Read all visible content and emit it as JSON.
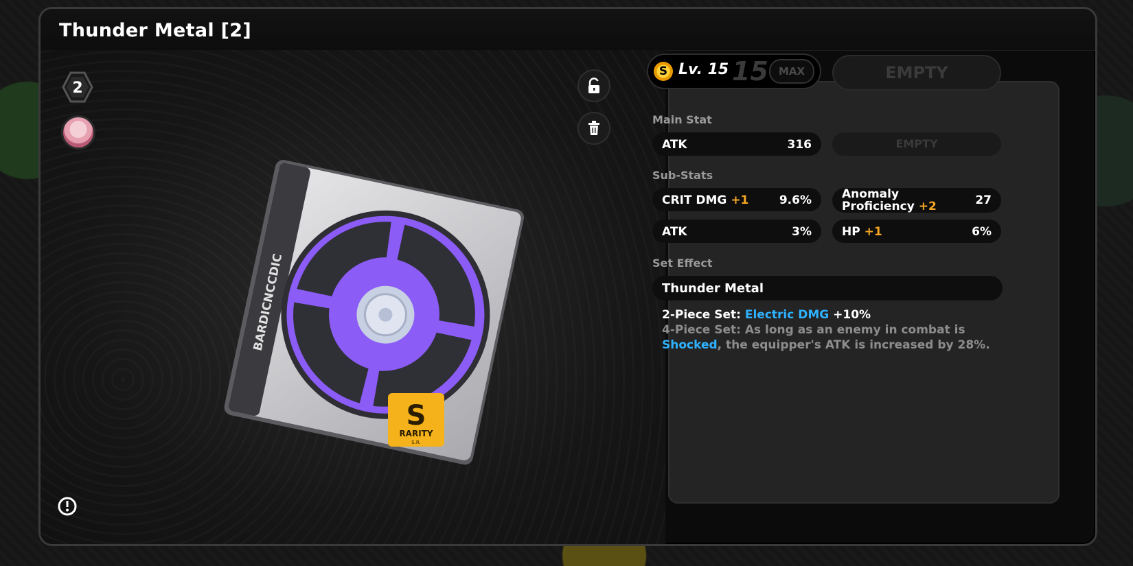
{
  "title": "Thunder Metal [2]",
  "slot_number": "2",
  "disc": {
    "spine_text": "BARDICNCCDIC",
    "rarity_letter": "S",
    "rarity_label": "RARITY",
    "rarity_sub": "S.R."
  },
  "level": {
    "coin_glyph": "S",
    "label": "Lv. 15",
    "value": "15",
    "max_label": "MAX",
    "empty_tab": "EMPTY"
  },
  "main_stat": {
    "heading": "Main Stat",
    "name": "ATK",
    "value": "316",
    "empty_label": "EMPTY"
  },
  "sub_stats": {
    "heading": "Sub-Stats",
    "items": [
      {
        "name": "CRIT DMG",
        "bonus": "+1",
        "value": "9.6%"
      },
      {
        "name": "Anomaly Proficiency",
        "bonus": "+2",
        "value": "27"
      },
      {
        "name": "ATK",
        "bonus": "",
        "value": "3%"
      },
      {
        "name": "HP",
        "bonus": "+1",
        "value": "6%"
      }
    ]
  },
  "set_effect": {
    "heading": "Set Effect",
    "name": "Thunder Metal",
    "two_piece_prefix": "2-Piece Set: ",
    "two_piece_highlight": "Electric DMG",
    "two_piece_suffix": " +10%",
    "four_piece_prefix": "4-Piece Set: As long as an enemy in combat is",
    "four_piece_highlight": "Shocked",
    "four_piece_suffix": ", the equipper's ATK is increased by 28%."
  },
  "colors": {
    "accent_orange": "#f5a623",
    "accent_blue": "#2fb2ff",
    "disc_purple": "#8b5cf6",
    "rarity_gold": "#f5b21a"
  },
  "icons": {
    "lock": "unlock-icon",
    "delete": "trash-icon",
    "info": "info-icon"
  }
}
